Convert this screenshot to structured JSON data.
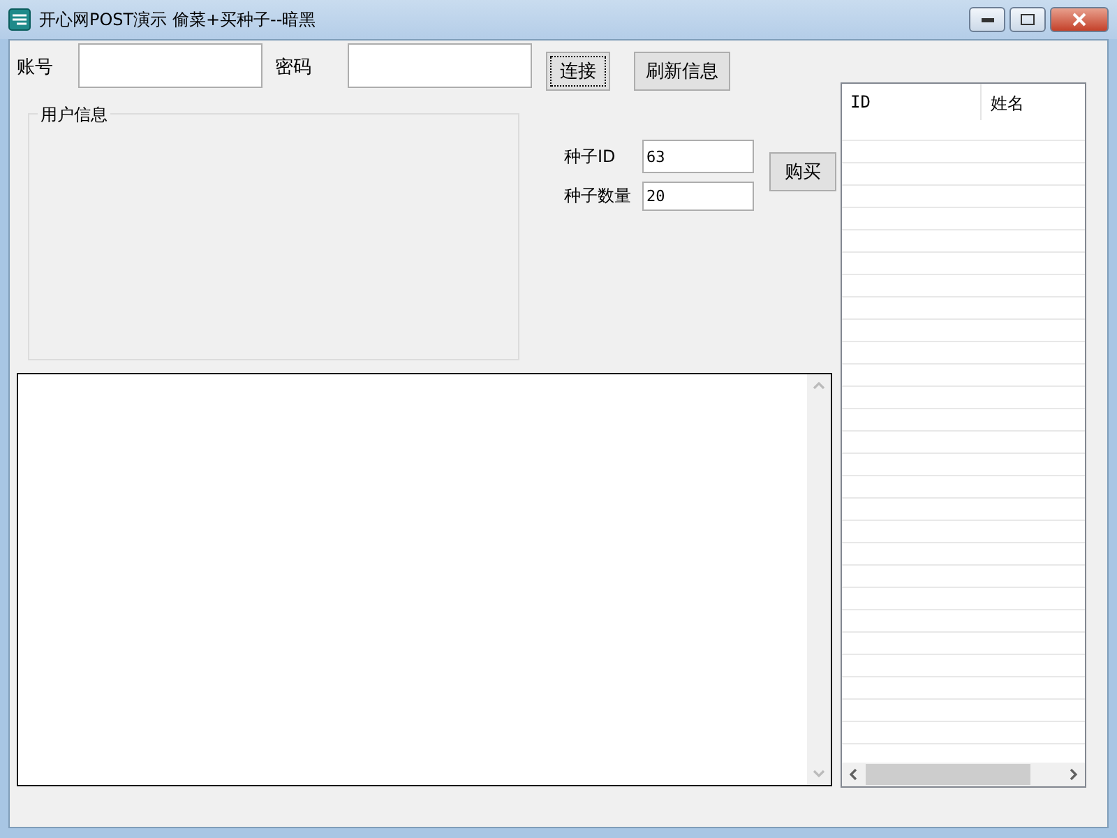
{
  "window": {
    "title": "开心网POST演示 偷菜+买种子--暗黑"
  },
  "login": {
    "account_label": "账号",
    "password_label": "密码",
    "connect_button": "连接",
    "refresh_button": "刷新信息"
  },
  "user_info": {
    "title": "用户信息"
  },
  "seed": {
    "fields": [
      {
        "label": "种子ID",
        "value": "63"
      },
      {
        "label": "种子数量",
        "value": "20"
      }
    ],
    "buy_button": "购买"
  },
  "list": {
    "columns": [
      "ID",
      "姓名"
    ]
  }
}
